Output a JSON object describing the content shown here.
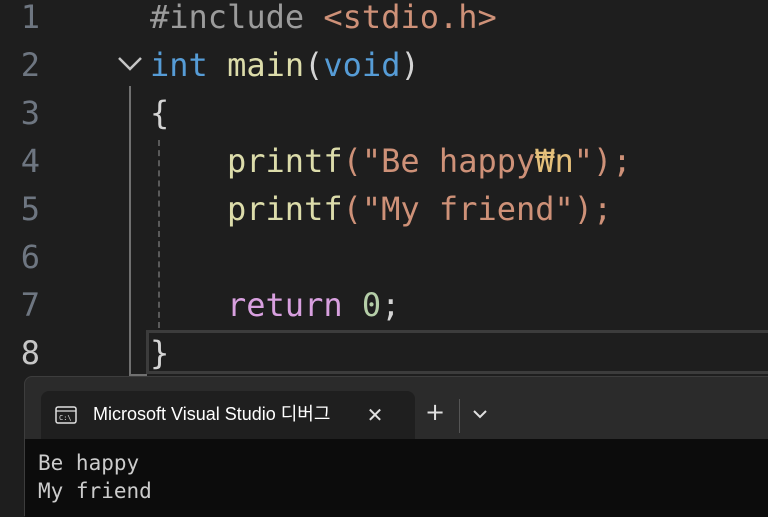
{
  "editor": {
    "line_numbers": [
      "1",
      "2",
      "3",
      "4",
      "5",
      "6",
      "7",
      "8"
    ],
    "active_line": "8",
    "lines": {
      "l1": {
        "include": "#include",
        "header": "<stdio.h>"
      },
      "l2": {
        "type": "int",
        "fn": "main",
        "open": "(",
        "param": "void",
        "close": ")"
      },
      "l3": {
        "brace": "{"
      },
      "l4": {
        "fn": "printf",
        "open": "(\"",
        "str": "Be happy",
        "esc": "₩n",
        "close": "\");"
      },
      "l5": {
        "fn": "printf",
        "open": "(\"",
        "str": "My friend",
        "close": "\");"
      },
      "l7": {
        "kw": "return",
        "num": "0",
        "semi": ";"
      },
      "l8": {
        "brace": "}"
      }
    }
  },
  "terminal": {
    "tab_title": "Microsoft Visual Studio 디버그",
    "close_symbol": "✕",
    "new_tab_symbol": "+",
    "output": [
      "Be happy",
      "My friend"
    ]
  },
  "colors": {
    "editor_bg": "#1e1e1e",
    "keyword": "#569cd6",
    "function": "#dcdcaa",
    "string": "#ce9178",
    "control_keyword": "#d8a0df",
    "number": "#b5cea8",
    "terminal_bg": "#0c0c0c",
    "terminal_chrome": "#2b2b2b"
  },
  "icons": {
    "fold": "chevron-down-icon",
    "tab": "console-icon",
    "close": "close-icon",
    "new_tab": "plus-icon",
    "dropdown": "chevron-down-icon"
  }
}
